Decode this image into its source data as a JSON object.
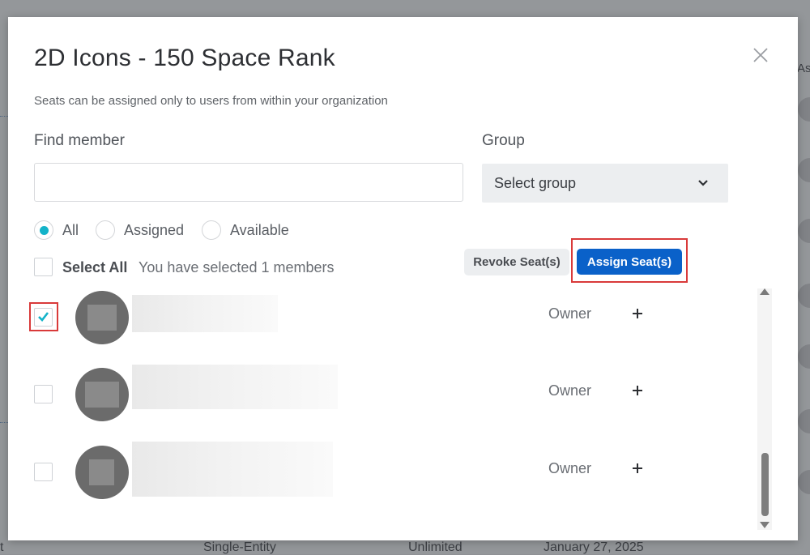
{
  "background": {
    "column_header_fragment": "As",
    "row": {
      "type": "Single-Entity",
      "limit": "Unlimited",
      "date": "January 27, 2025"
    },
    "left_fragment": "t"
  },
  "modal": {
    "title": "2D Icons - 150 Space Rank",
    "subtitle": "Seats can be assigned only to users from within your organization",
    "find_member": {
      "label": "Find member",
      "value": "",
      "placeholder": ""
    },
    "group": {
      "label": "Group",
      "selected": "Select group"
    },
    "filters": [
      {
        "label": "All",
        "selected": true
      },
      {
        "label": "Assigned",
        "selected": false
      },
      {
        "label": "Available",
        "selected": false
      }
    ],
    "select_all": {
      "label": "Select All",
      "status": "You have selected 1 members"
    },
    "actions": {
      "revoke": "Revoke Seat(s)",
      "assign": "Assign Seat(s)"
    },
    "members": [
      {
        "role": "Owner",
        "checked": true
      },
      {
        "role": "Owner",
        "checked": false
      },
      {
        "role": "Owner",
        "checked": false
      }
    ]
  },
  "colors": {
    "accent": "#13b3c9",
    "primary_button": "#0a61c9",
    "highlight": "#d93a3a"
  },
  "icons": {
    "close": "close-icon",
    "chevron": "chevron-down-icon",
    "check": "checkmark-icon",
    "plus": "plus-icon"
  }
}
